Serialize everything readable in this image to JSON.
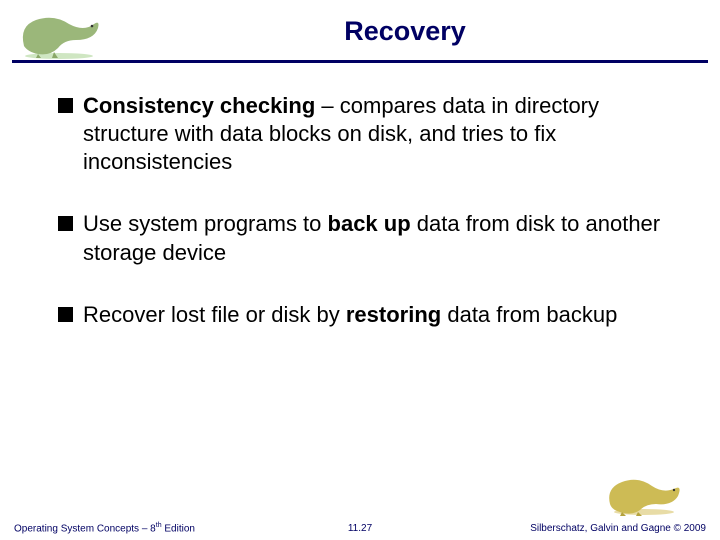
{
  "header": {
    "title": "Recovery"
  },
  "bullets": [
    {
      "bold1": "Consistency checking",
      "plain1": " – compares data in directory structure with data blocks on disk, and tries to fix inconsistencies"
    },
    {
      "plain1": "Use system programs to ",
      "bold1": "back up",
      "plain2": " data from disk to another storage device"
    },
    {
      "plain1": "Recover lost file or disk by ",
      "bold1": "restoring",
      "plain2": " data from backup"
    }
  ],
  "footer": {
    "left1": "Operating System Concepts – 8",
    "left_sup": "th",
    "left2": " Edition",
    "center": "11.27",
    "right": "Silberschatz, Galvin and Gagne © 2009"
  }
}
